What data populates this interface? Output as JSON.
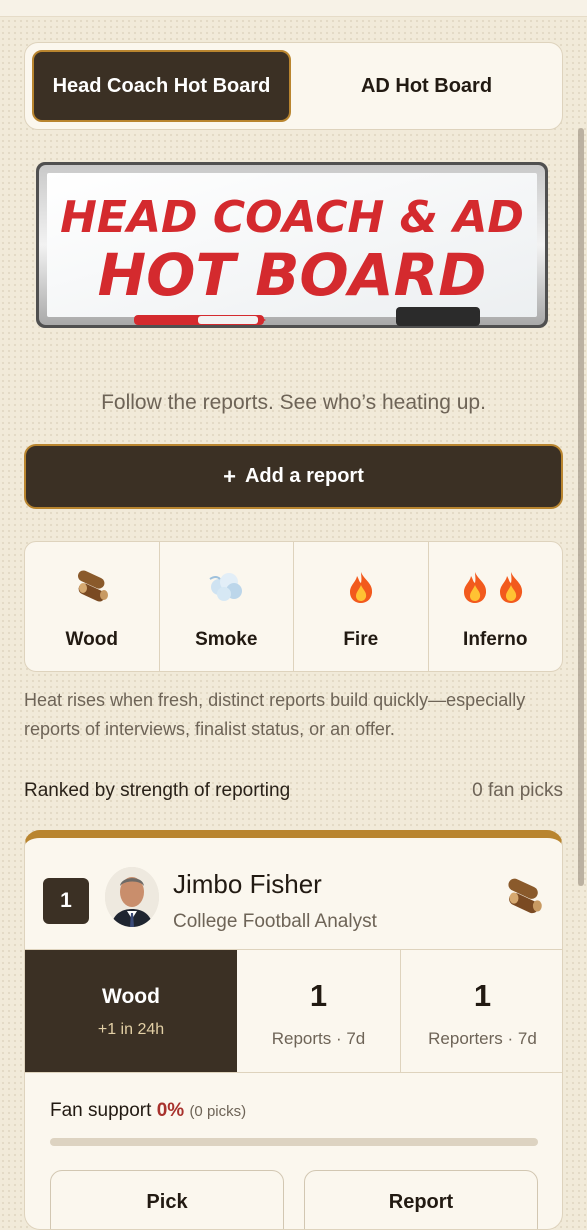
{
  "tabs": [
    {
      "label": "Head Coach Hot Board",
      "active": true
    },
    {
      "label": "AD Hot Board",
      "active": false
    }
  ],
  "board_image": {
    "line1": "HEAD COACH & AD",
    "line2": "HOT BOARD"
  },
  "tagline": "Follow the reports. See who’s heating up.",
  "add_report": {
    "icon": "plus-icon",
    "label": "Add a report"
  },
  "heat_levels": [
    {
      "label": "Wood",
      "icon": "wood-logs-icon"
    },
    {
      "label": "Smoke",
      "icon": "smoke-cloud-icon"
    },
    {
      "label": "Fire",
      "icon": "fire-icon"
    },
    {
      "label": "Inferno",
      "icon": "double-fire-icon"
    }
  ],
  "heat_note": "Heat rises when fresh, distinct reports build quickly—especially reports of interviews, finalist status, or an offer.",
  "ranking": {
    "title": "Ranked by strength of reporting",
    "fan_picks": "0 fan picks"
  },
  "candidates": [
    {
      "rank": "1",
      "name": "Jimbo Fisher",
      "role": "College Football Analyst",
      "heat_icon": "wood-logs-icon",
      "heat": {
        "level": "Wood",
        "delta": "+1 in 24h"
      },
      "reports": {
        "value": "1",
        "label": "Reports · 7d"
      },
      "reporters": {
        "value": "1",
        "label": "Reporters · 7d"
      },
      "fan_support": {
        "label": "Fan support",
        "percent": "0%",
        "picks": "(0 picks)",
        "fraction": 0
      },
      "actions": [
        "Pick",
        "Report"
      ]
    }
  ],
  "colors": {
    "accent_dark": "#3b3024",
    "accent_gold": "#b9852f",
    "marker_red": "#d42a2e",
    "fan_red": "#a8322d"
  }
}
